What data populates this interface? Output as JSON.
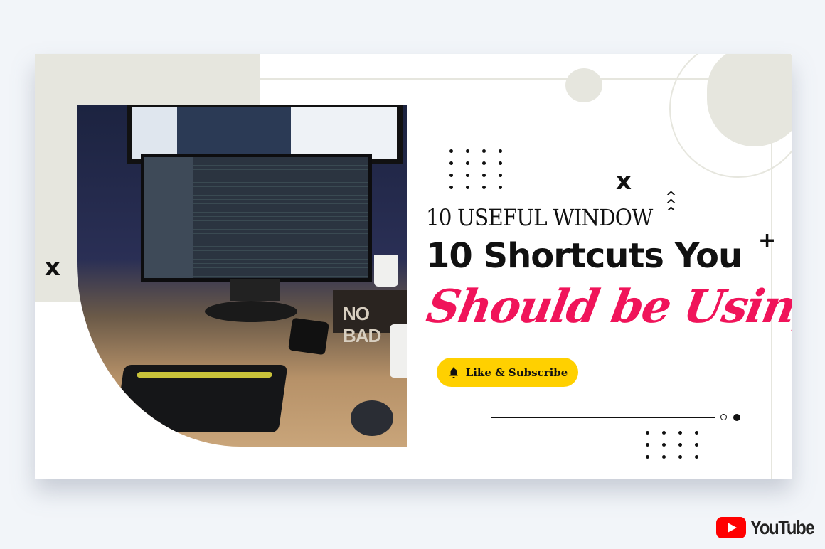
{
  "thumbnail": {
    "headline_line1": "10 USEFUL WINDOW",
    "headline_line2": "10 Shortcuts You",
    "headline_script": "Should be Using!",
    "button_label": "Like & Subscribe",
    "button_icon": "bell-icon",
    "decor_x": "x",
    "decor_plus": "+",
    "decor_carets": "^\n^\n^",
    "photo_sign_text": "NO BAD",
    "accent_color": "#f0145a",
    "button_color": "#ffd000",
    "beige_color": "#e6e6de"
  },
  "branding": {
    "wordmark": "YouTube",
    "logo_icon": "youtube-play-icon",
    "logo_color": "#ff0000"
  }
}
